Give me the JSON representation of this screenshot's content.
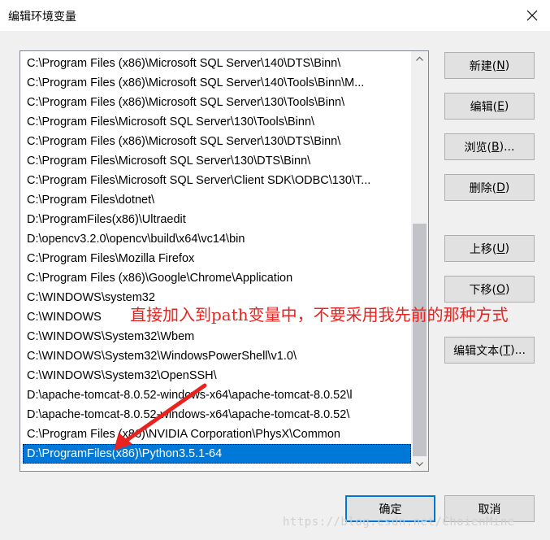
{
  "dialog": {
    "title": "编辑环境变量",
    "close_icon": "close-icon"
  },
  "path_list": {
    "items": [
      "C:\\Program Files (x86)\\Microsoft SQL Server\\140\\DTS\\Binn\\",
      "C:\\Program Files (x86)\\Microsoft SQL Server\\140\\Tools\\Binn\\M...",
      "C:\\Program Files (x86)\\Microsoft SQL Server\\130\\Tools\\Binn\\",
      "C:\\Program Files\\Microsoft SQL Server\\130\\Tools\\Binn\\",
      "C:\\Program Files (x86)\\Microsoft SQL Server\\130\\DTS\\Binn\\",
      "C:\\Program Files\\Microsoft SQL Server\\130\\DTS\\Binn\\",
      "C:\\Program Files\\Microsoft SQL Server\\Client SDK\\ODBC\\130\\T...",
      "C:\\Program Files\\dotnet\\",
      "D:\\ProgramFiles(x86)\\Ultraedit",
      "D:\\opencv3.2.0\\opencv\\build\\x64\\vc14\\bin",
      "C:\\Program Files\\Mozilla Firefox",
      "C:\\Program Files (x86)\\Google\\Chrome\\Application",
      "C:\\WINDOWS\\system32",
      "C:\\WINDOWS",
      "C:\\WINDOWS\\System32\\Wbem",
      "C:\\WINDOWS\\System32\\WindowsPowerShell\\v1.0\\",
      "C:\\WINDOWS\\System32\\OpenSSH\\",
      "D:\\apache-tomcat-8.0.52-windows-x64\\apache-tomcat-8.0.52\\l",
      "D:\\apache-tomcat-8.0.52-windows-x64\\apache-tomcat-8.0.52\\",
      "C:\\Program Files (x86)\\NVIDIA Corporation\\PhysX\\Common",
      "D:\\ProgramFiles(x86)\\Python3.5.1-64"
    ],
    "selected_index": 20,
    "scroll_up_icon": "chevron-up-icon",
    "scroll_down_icon": "chevron-down-icon"
  },
  "buttons": {
    "new": {
      "label": "新建(",
      "key": "N",
      "suffix": ")"
    },
    "edit": {
      "label": "编辑(",
      "key": "E",
      "suffix": ")"
    },
    "browse": {
      "label": "浏览(",
      "key": "B",
      "suffix": ")..."
    },
    "delete": {
      "label": "删除(",
      "key": "D",
      "suffix": ")"
    },
    "move_up": {
      "label": "上移(",
      "key": "U",
      "suffix": ")"
    },
    "move_down": {
      "label": "下移(",
      "key": "O",
      "suffix": ")"
    },
    "edit_text": {
      "label": "编辑文本(",
      "key": "T",
      "suffix": ")..."
    },
    "ok": "确定",
    "cancel": "取消"
  },
  "annotation": {
    "text": "直接加入到path变量中，不要采用我先前的那种方式",
    "color": "#e8231f"
  },
  "watermark": "https://blog.csdn.net/ChoienMine",
  "colors": {
    "selection": "#0078d7",
    "default_button_border": "#0078d7"
  }
}
